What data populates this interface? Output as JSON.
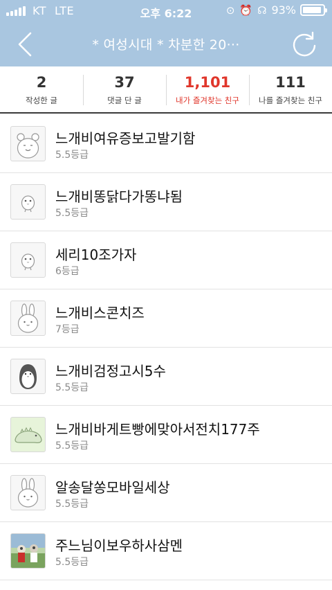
{
  "status_bar": {
    "carrier": "KT",
    "network": "LTE",
    "time": "오후 6:22",
    "battery_text": "93%",
    "battery_level": 0.93
  },
  "nav": {
    "title": "* 여성시대 *  차분한 20···"
  },
  "stats": [
    {
      "num": "2",
      "label": "작성한 글"
    },
    {
      "num": "37",
      "label": "댓글 단 글"
    },
    {
      "num": "1,101",
      "label": "내가 즐겨찾는 친구"
    },
    {
      "num": "111",
      "label": "나를 즐겨찾는 친구"
    }
  ],
  "friends": [
    {
      "name": "느개비여유증보고발기함",
      "grade": "5.5등급",
      "avatar": "bear-icon"
    },
    {
      "name": "느개비똥닭다가똥냐됨",
      "grade": "5.5등급",
      "avatar": "chick-icon"
    },
    {
      "name": "세리10조가자",
      "grade": "6등급",
      "avatar": "chick-icon"
    },
    {
      "name": "느개비스콘치즈",
      "grade": "7등급",
      "avatar": "rabbit-icon"
    },
    {
      "name": "느개비검정고시5수",
      "grade": "5.5등급",
      "avatar": "penguin-icon"
    },
    {
      "name": "느개비바게트빵에맞아서전치177주",
      "grade": "5.5등급",
      "avatar": "dino-icon"
    },
    {
      "name": "알송달쏭모바일세상",
      "grade": "5.5등급",
      "avatar": "rabbit-icon"
    },
    {
      "name": "주느님이보우하사삼멘",
      "grade": "5.5등급",
      "avatar": "photo-icon"
    }
  ],
  "colors": {
    "header": "#a9c6e0",
    "active": "#e0362b"
  }
}
